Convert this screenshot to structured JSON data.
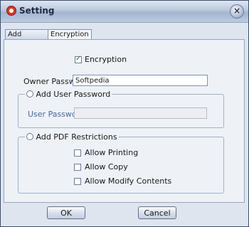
{
  "window": {
    "title": "Setting",
    "close_glyph": "×"
  },
  "tabs": [
    {
      "label": "Add Watermark",
      "active": false
    },
    {
      "label": "Encryption",
      "active": true
    }
  ],
  "encryption": {
    "checkbox_label": "Encryption",
    "checked": true,
    "owner_password_label": "Owner Password",
    "owner_password_value": "Softpedia",
    "user_password_group": {
      "radio_label": "Add User Password",
      "selected": false,
      "field_label": "User Password",
      "field_value": ""
    },
    "restrictions_group": {
      "radio_label": "Add PDF Restrictions",
      "selected": false,
      "options": [
        {
          "label": "Allow Printing",
          "checked": false
        },
        {
          "label": "Allow Copy",
          "checked": false
        },
        {
          "label": "Allow Modify Contents",
          "checked": false
        }
      ]
    }
  },
  "footer": {
    "ok_label": "OK",
    "cancel_label": "Cancel"
  },
  "colors": {
    "accent": "#3b5fa0",
    "disabled_label": "#4a6aa3"
  },
  "icons": {
    "app": "app-logo-icon",
    "close": "close-icon"
  }
}
